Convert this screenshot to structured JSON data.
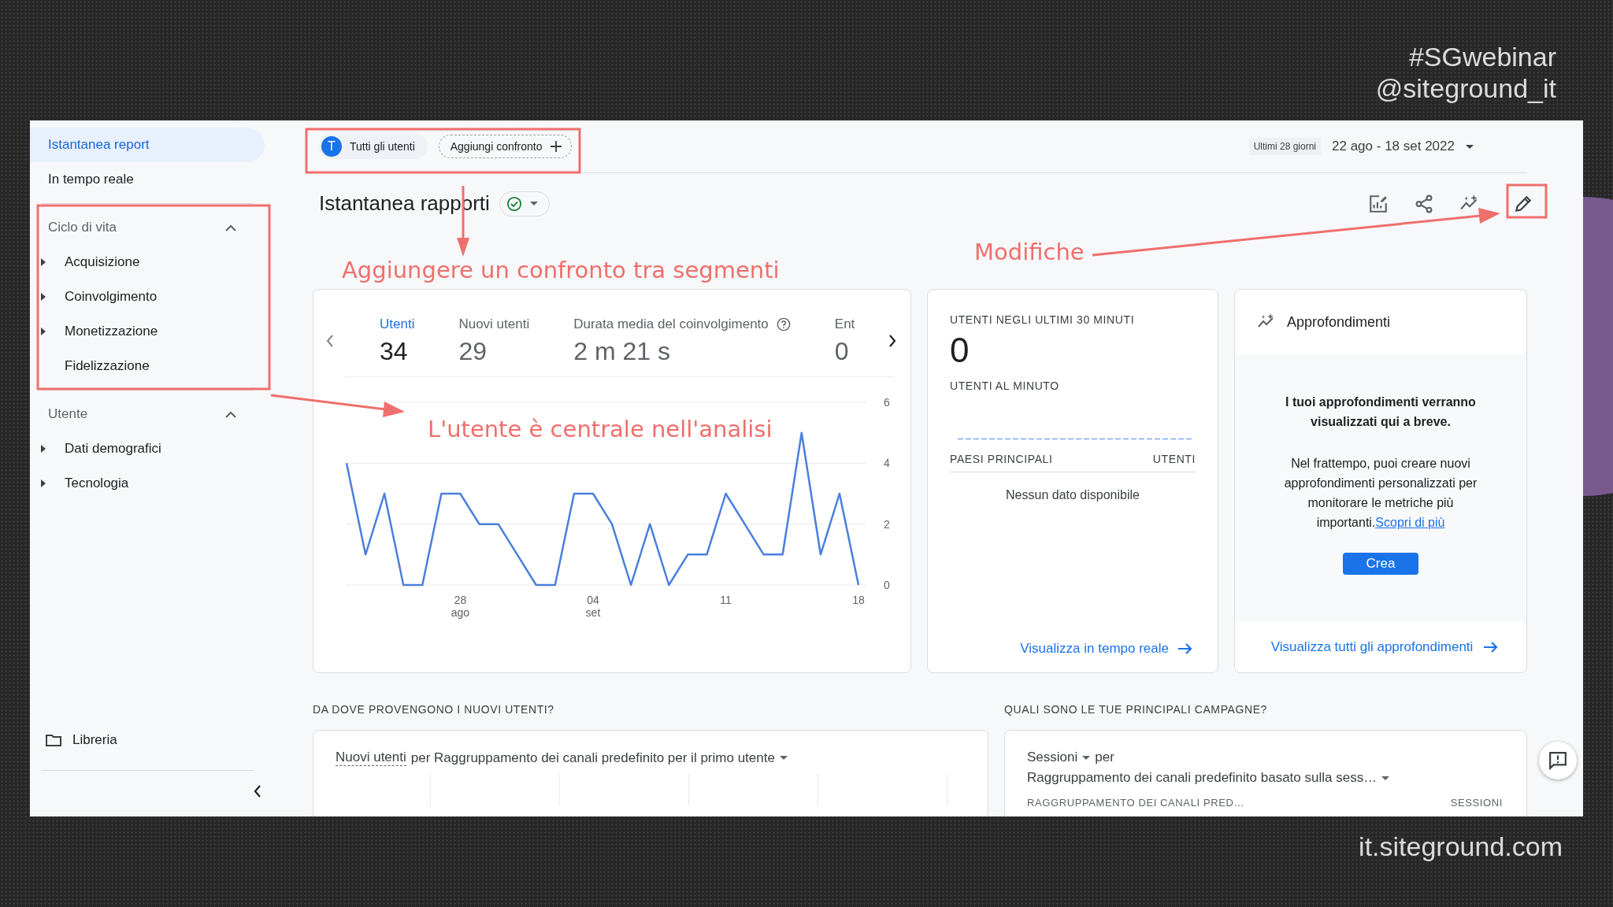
{
  "slide": {
    "hashtag": "#SGwebinar",
    "handle": "@siteground_it",
    "website": "it.siteground.com"
  },
  "sidebar": {
    "items": [
      {
        "label": "Istantanea report",
        "selected": true
      },
      {
        "label": "In tempo reale",
        "selected": false
      }
    ],
    "sections": [
      {
        "title": "Ciclo di vita",
        "expanded": true,
        "items": [
          {
            "label": "Acquisizione",
            "expandable": true
          },
          {
            "label": "Coinvolgimento",
            "expandable": true
          },
          {
            "label": "Monetizzazione",
            "expandable": true
          },
          {
            "label": "Fidelizzazione",
            "expandable": false
          }
        ]
      },
      {
        "title": "Utente",
        "expanded": true,
        "items": [
          {
            "label": "Dati demografici",
            "expandable": true
          },
          {
            "label": "Tecnologia",
            "expandable": true
          }
        ]
      }
    ],
    "library": "Libreria"
  },
  "toolbar": {
    "segment_initial": "T",
    "segment": "Tutti gli utenti",
    "add_comparison": "Aggiungi confronto",
    "date_range_label": "Ultimi 28 giorni",
    "date_range": "22 ago - 18 set 2022"
  },
  "page": {
    "title": "Istantanea rapporti"
  },
  "overview_card": {
    "metrics": [
      {
        "label": "Utenti",
        "value": "34",
        "selected": true,
        "help": false
      },
      {
        "label": "Nuovi utenti",
        "value": "29",
        "selected": false,
        "help": false
      },
      {
        "label": "Durata media del coinvolgimento",
        "value": "2 m 21 s",
        "selected": false,
        "help": true
      },
      {
        "label": "Ent",
        "value": "0",
        "selected": false,
        "help": false
      }
    ],
    "chart_data": {
      "type": "line",
      "categories": [
        null,
        null,
        null,
        null,
        null,
        null,
        "28 ago",
        null,
        null,
        null,
        null,
        null,
        null,
        "04 set",
        null,
        null,
        null,
        null,
        null,
        null,
        "11",
        null,
        null,
        null,
        null,
        null,
        null,
        "18"
      ],
      "series": [
        {
          "color": "#4a7fdc",
          "values": [
            4,
            1,
            3,
            0,
            0,
            3,
            3,
            2,
            2,
            1,
            0,
            0,
            3,
            3,
            2,
            0,
            2,
            0,
            1,
            1,
            3,
            2,
            1,
            1,
            5,
            1,
            3,
            0
          ]
        }
      ],
      "ylim": [
        0,
        6
      ],
      "yticks": [
        0,
        2,
        4,
        6
      ]
    }
  },
  "realtime_card": {
    "title": "UTENTI NEGLI ULTIMI 30 MINUTI",
    "value": "0",
    "per_minute_label": "UTENTI AL MINUTO",
    "columns": [
      "PAESI PRINCIPALI",
      "UTENTI"
    ],
    "empty": "Nessun dato disponibile",
    "link": "Visualizza in tempo reale"
  },
  "insights_card": {
    "title": "Approfondimenti",
    "headline": "I tuoi approfondimenti verranno visualizzati qui a breve.",
    "body": "Nel frattempo, puoi creare nuovi approfondimenti personalizzati per monitorare le metriche più importanti.",
    "body_link": "Scopri di più",
    "button": "Crea",
    "link": "Visualizza tutti gli approfondimenti"
  },
  "new_users_card": {
    "heading": "DA DOVE PROVENGONO I NUOVI UTENTI?",
    "metric": "Nuovi utenti",
    "dimension": "per Raggruppamento dei canali predefinito per il primo utente"
  },
  "campaigns_card": {
    "heading": "QUALI SONO LE TUE PRINCIPALI CAMPAGNE?",
    "metric": "Sessioni",
    "connector": "per",
    "dimension": "Raggruppamento dei canali predefinito basato sulla sess…",
    "columns": [
      "RAGGRUPPAMENTO DEI CANALI PRED…",
      "SESSIONI"
    ]
  },
  "annotations": [
    {
      "text": "Aggiungere un confronto tra segmenti"
    },
    {
      "text": "Modifiche"
    },
    {
      "text": "L'utente è centrale nell'analisi"
    }
  ]
}
